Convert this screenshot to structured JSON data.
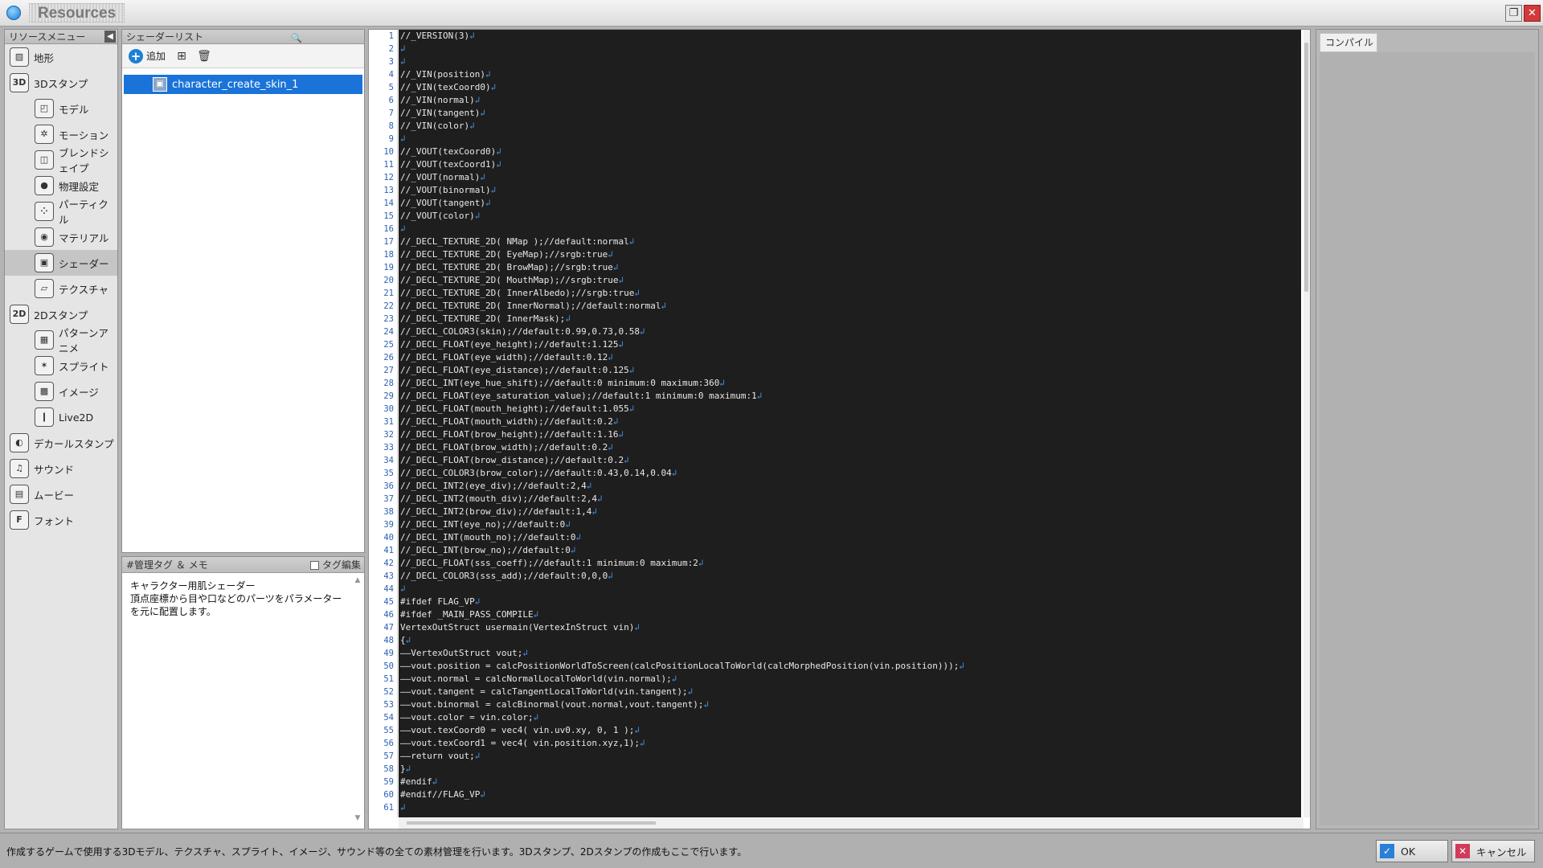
{
  "window": {
    "title": "Resources",
    "restore_glyph": "❐",
    "close_glyph": "✕"
  },
  "sidebar": {
    "header": "リソースメニュー",
    "collapse_glyph": "◀",
    "items": [
      {
        "label": "地形",
        "icon": "terrain-icon",
        "glyph": "▨",
        "level": 0
      },
      {
        "label": "3Dスタンプ",
        "icon": "3d-stamp-icon",
        "glyph": "3D",
        "level": 0
      },
      {
        "label": "モデル",
        "icon": "model-icon",
        "glyph": "◰",
        "level": 1
      },
      {
        "label": "モーション",
        "icon": "motion-icon",
        "glyph": "✲",
        "level": 1
      },
      {
        "label": "ブレンドシェイプ",
        "icon": "blendshape-icon",
        "glyph": "◫",
        "level": 1
      },
      {
        "label": "物理設定",
        "icon": "physics-icon",
        "glyph": "●",
        "level": 1
      },
      {
        "label": "パーティクル",
        "icon": "particle-icon",
        "glyph": "⁘",
        "level": 1
      },
      {
        "label": "マテリアル",
        "icon": "material-icon",
        "glyph": "◉",
        "level": 1
      },
      {
        "label": "シェーダー",
        "icon": "shader-icon",
        "glyph": "▣",
        "level": 1,
        "selected": true
      },
      {
        "label": "テクスチャ",
        "icon": "texture-icon",
        "glyph": "▱",
        "level": 1
      },
      {
        "label": "2Dスタンプ",
        "icon": "2d-stamp-icon",
        "glyph": "2D",
        "level": 0
      },
      {
        "label": "パターンアニメ",
        "icon": "pattern-anim-icon",
        "glyph": "▦",
        "level": 1
      },
      {
        "label": "スプライト",
        "icon": "sprite-icon",
        "glyph": "✶",
        "level": 1
      },
      {
        "label": "イメージ",
        "icon": "image-icon",
        "glyph": "▩",
        "level": 1
      },
      {
        "label": "Live2D",
        "icon": "live2d-icon",
        "glyph": "❙",
        "level": 1
      },
      {
        "label": "デカールスタンプ",
        "icon": "decal-stamp-icon",
        "glyph": "◐",
        "level": 0
      },
      {
        "label": "サウンド",
        "icon": "sound-icon",
        "glyph": "♫",
        "level": 0
      },
      {
        "label": "ムービー",
        "icon": "movie-icon",
        "glyph": "▤",
        "level": 0
      },
      {
        "label": "フォント",
        "icon": "font-icon",
        "glyph": "F",
        "level": 0
      }
    ]
  },
  "shader_list": {
    "header": "シェーダーリスト",
    "search_glyph": "🔍",
    "add_label": "追加",
    "plus_glyph": "+",
    "new_glyph": "⊞",
    "delete_glyph": "🗑",
    "item": {
      "name": "character_create_skin_1",
      "glyph": "▣"
    }
  },
  "memo": {
    "header": "#管理タグ ＆ メモ",
    "tag_edit_label": "タグ編集",
    "line1": "キャラクター用肌シェーダー",
    "line2": "頂点座標から目や口などのパーツをパラメーターを元に配置します。",
    "up_glyph": "▲",
    "down_glyph": "▼"
  },
  "editor": {
    "return_glyph": "↲",
    "lines": [
      "//_VERSION(3)",
      "",
      "",
      "//_VIN(position)",
      "//_VIN(texCoord0)",
      "//_VIN(normal)",
      "//_VIN(tangent)",
      "//_VIN(color)",
      "",
      "//_VOUT(texCoord0)",
      "//_VOUT(texCoord1)",
      "//_VOUT(normal)",
      "//_VOUT(binormal)",
      "//_VOUT(tangent)",
      "//_VOUT(color)",
      "",
      "//_DECL_TEXTURE_2D( NMap );//default:normal",
      "//_DECL_TEXTURE_2D( EyeMap);//srgb:true",
      "//_DECL_TEXTURE_2D( BrowMap);//srgb:true",
      "//_DECL_TEXTURE_2D( MouthMap);//srgb:true",
      "//_DECL_TEXTURE_2D( InnerAlbedo);//srgb:true",
      "//_DECL_TEXTURE_2D( InnerNormal);//default:normal",
      "//_DECL_TEXTURE_2D( InnerMask);",
      "//_DECL_COLOR3(skin);//default:0.99,0.73,0.58",
      "//_DECL_FLOAT(eye_height);//default:1.125",
      "//_DECL_FLOAT(eye_width);//default:0.12",
      "//_DECL_FLOAT(eye_distance);//default:0.125",
      "//_DECL_INT(eye_hue_shift);//default:0 minimum:0 maximum:360",
      "//_DECL_FLOAT(eye_saturation_value);//default:1 minimum:0 maximum:1",
      "//_DECL_FLOAT(mouth_height);//default:1.055",
      "//_DECL_FLOAT(mouth_width);//default:0.2",
      "//_DECL_FLOAT(brow_height);//default:1.16",
      "//_DECL_FLOAT(brow_width);//default:0.2",
      "//_DECL_FLOAT(brow_distance);//default:0.2",
      "//_DECL_COLOR3(brow_color);//default:0.43,0.14,0.04",
      "//_DECL_INT2(eye_div);//default:2,4",
      "//_DECL_INT2(mouth_div);//default:2,4",
      "//_DECL_INT2(brow_div);//default:1,4",
      "//_DECL_INT(eye_no);//default:0",
      "//_DECL_INT(mouth_no);//default:0",
      "//_DECL_INT(brow_no);//default:0",
      "//_DECL_FLOAT(sss_coeff);//default:1 minimum:0 maximum:2",
      "//_DECL_COLOR3(sss_add);//default:0,0,0",
      "",
      "#ifdef FLAG_VP",
      "#ifdef _MAIN_PASS_COMPILE",
      "VertexOutStruct usermain(VertexInStruct vin)",
      "{",
      "——VertexOutStruct vout;",
      "——vout.position = calcPositionWorldToScreen(calcPositionLocalToWorld(calcMorphedPosition(vin.position)));",
      "——vout.normal = calcNormalLocalToWorld(vin.normal);",
      "——vout.tangent = calcTangentLocalToWorld(vin.tangent);",
      "——vout.binormal = calcBinormal(vout.normal,vout.tangent);",
      "——vout.color = vin.color;",
      "——vout.texCoord0 = vec4( vin.uv0.xy, 0, 1 );",
      "——vout.texCoord1 = vec4( vin.position.xyz,1);",
      "——return vout;",
      "}",
      "#endif",
      "#endif//FLAG_VP",
      ""
    ]
  },
  "compile": {
    "tab_label": "コンパイル"
  },
  "status": {
    "text": "作成するゲームで使用する3Dモデル、テクスチャ、スプライト、イメージ、サウンド等の全ての素材管理を行います。3Dスタンプ、2Dスタンプの作成もここで行います。",
    "ok_label": "OK",
    "ok_glyph": "✓",
    "cancel_label": "キャンセル",
    "cancel_glyph": "✕"
  }
}
